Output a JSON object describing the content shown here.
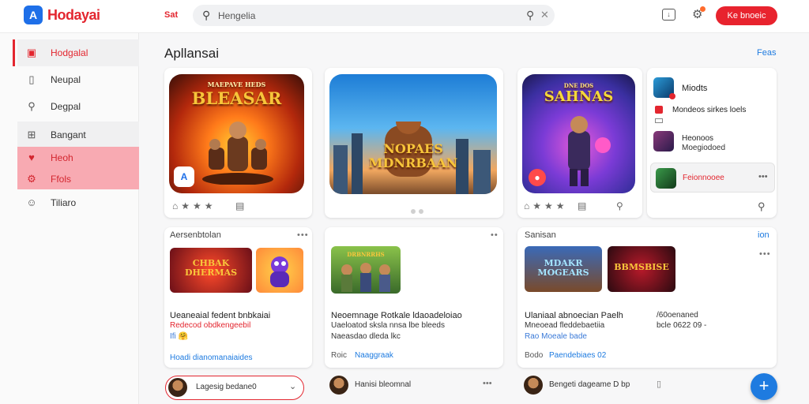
{
  "header": {
    "logo_mark": "A",
    "logo_text": "Hodayai",
    "link": "Sat",
    "search_text": "Hengelia",
    "cta_label": "Ke bnoeic"
  },
  "sidebar": {
    "items": [
      {
        "label": "Hodgalal",
        "icon": "store-icon"
      },
      {
        "label": "Neupal",
        "icon": "document-icon"
      },
      {
        "label": "Degpal",
        "icon": "search-icon"
      },
      {
        "label": "Bangant",
        "icon": "grid-icon"
      },
      {
        "label": "Heoh",
        "icon": "heart-icon"
      },
      {
        "label": "Ffols",
        "icon": "gear-icon"
      },
      {
        "label": "Tiliaro",
        "icon": "chat-icon"
      }
    ]
  },
  "main": {
    "title": "Apllansai",
    "more_link": "Feas",
    "featured": [
      {
        "art_title": "BLEASAR",
        "art_sub": "MAEPAVE HEDS",
        "badge": "A"
      },
      {
        "art_title": "NOPAES MDNRBAAN"
      },
      {
        "art_title": "SAHNAS",
        "art_sub": "DNE DOS"
      }
    ],
    "side_list": [
      {
        "line1": "Miodts",
        "line2": ""
      },
      {
        "line1": "Mondeos sirkes loels",
        "line2": ""
      },
      {
        "line1": "Heonoos",
        "line2": "Moegiodoed"
      },
      {
        "line1": "Feionnooee",
        "line2": ""
      }
    ],
    "sections": [
      {
        "title": "Aersenbtolan",
        "tiles": [
          "CHBAK DHERMAS",
          ""
        ],
        "line1": "Ueaneaial fedent bnbkaiai",
        "line2": "Redecod obdkengeebil",
        "line3": "Ifi 🤗",
        "link": "Hoadi dianomanaiaides",
        "input_value": "Lagesig bedane0"
      },
      {
        "title": "",
        "tiles": [
          "DRBNRRHS"
        ],
        "line1": "Neoemnage Rotkale ldaoadeloiao",
        "line2": "Uaeloatod sksla nnsa lbe bleeds",
        "line3": "Naeasdao dleda lkc",
        "link_prefix": "Roic",
        "link": "Naaggraak",
        "footer": "Hanisi bleomnal"
      },
      {
        "title": "Sanisan",
        "more": "ion",
        "tiles": [
          "MDAKR MOGEARS",
          "BBMSBISE"
        ],
        "line1": "Ulaniaal abnoecian Paelh",
        "line2": "Mneoead fleddebaetiia",
        "line3": "Rao Moeale bade",
        "line1_right": "/60oenaned",
        "line2_right": "bcle 0622 09 -",
        "link_prefix": "Bodo",
        "link": "Paendebiaes 02",
        "footer": "Bengeti dageame D bp"
      }
    ]
  },
  "colors": {
    "brand_red": "#e3262f",
    "accent_blue": "#1e7be0",
    "sidebar_highlight": "#f8aab2"
  }
}
